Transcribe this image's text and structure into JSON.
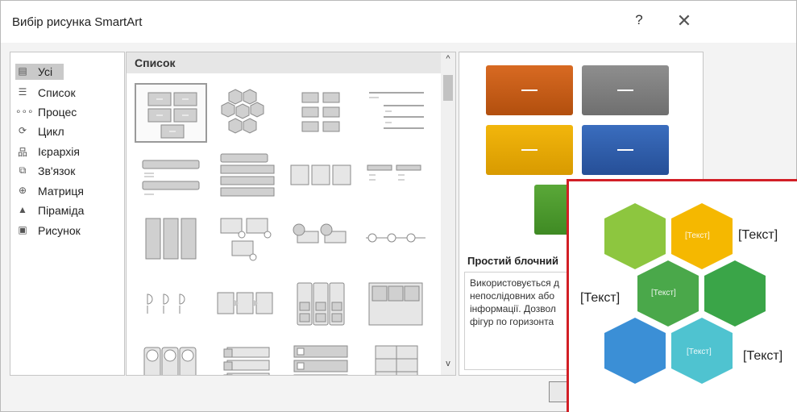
{
  "dialog": {
    "title": "Вибір рисунка SmartArt",
    "help_label": "?",
    "close_label": "✕"
  },
  "categories": [
    {
      "label": "Усі",
      "icon": "all-icon"
    },
    {
      "label": "Список",
      "icon": "list-icon"
    },
    {
      "label": "Процес",
      "icon": "process-icon"
    },
    {
      "label": "Цикл",
      "icon": "cycle-icon"
    },
    {
      "label": "Ієрархія",
      "icon": "hierarchy-icon"
    },
    {
      "label": "Зв'язок",
      "icon": "relationship-icon"
    },
    {
      "label": "Матриця",
      "icon": "matrix-icon"
    },
    {
      "label": "Піраміда",
      "icon": "pyramid-icon"
    },
    {
      "label": "Рисунок",
      "icon": "picture-icon"
    }
  ],
  "gallery": {
    "header": "Список",
    "selected_index": 0
  },
  "preview": {
    "colors": [
      "#c55a11",
      "#7f7f7f",
      "#e6a700",
      "#2e5fab",
      "#4e9a2f"
    ],
    "title": "Простий блочний",
    "description_lines": [
      "Використовується д",
      "непослідовних або",
      "інформації. Дозвол",
      "фігур по горизонта"
    ]
  },
  "overlay": {
    "labels": [
      "[Текст]",
      "[Текст]",
      "[Текст]"
    ],
    "hex_texts": [
      "[Текст]",
      "[Текст]",
      "[Текст]"
    ],
    "colors": [
      "#8dc63f",
      "#f5b800",
      "#4aa84a",
      "#3aa548",
      "#3b8fd6",
      "#4fc3d0"
    ]
  }
}
